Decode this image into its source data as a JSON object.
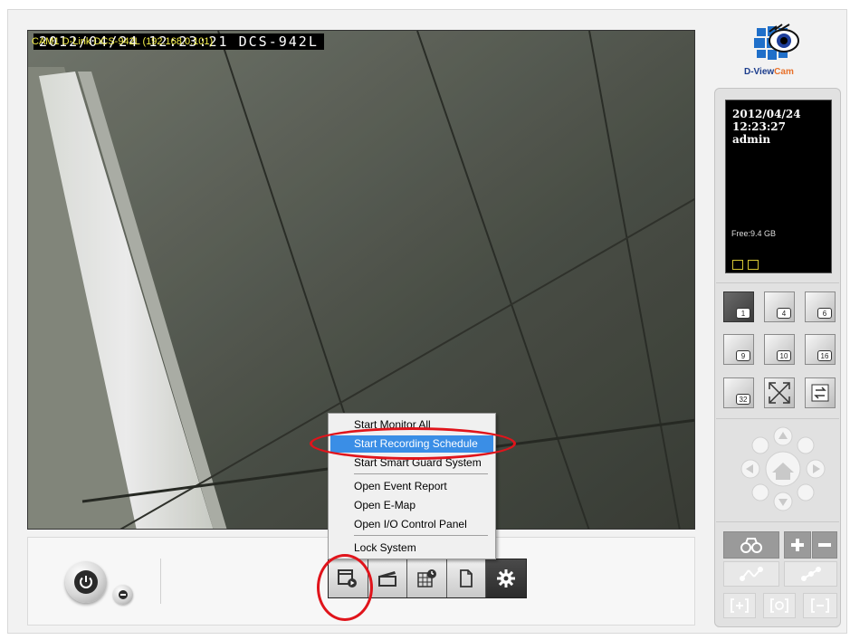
{
  "camera": {
    "osd_text": "2012/04/24 12:23:21  DCS-942L",
    "info_text": "CAM1 D-Link DCS-942L (192.168.0.101)"
  },
  "brand": {
    "logo_text_1": "D-View",
    "logo_text_2": "Cam"
  },
  "status_panel": {
    "date": "2012/04/24",
    "time": "12:23:27",
    "user": "admin",
    "free_space": "Free:9.4 GB"
  },
  "context_menu": {
    "items": [
      {
        "label": "Start Monitor All",
        "highlighted": false
      },
      {
        "label": "Start Recording Schedule",
        "highlighted": true
      },
      {
        "label": "Start Smart Guard System",
        "highlighted": false
      },
      {
        "label": "Open Event Report",
        "highlighted": false
      },
      {
        "label": "Open E-Map",
        "highlighted": false
      },
      {
        "label": "Open I/O Control Panel",
        "highlighted": false
      },
      {
        "label": "Lock System",
        "highlighted": false
      }
    ]
  },
  "toolbar": {
    "buttons": [
      "schedule-icon",
      "clapperboard-icon",
      "grid-clock-icon",
      "document-icon",
      "gear-icon"
    ]
  },
  "layout_buttons": [
    "1",
    "4",
    "6",
    "9",
    "10",
    "16",
    "32"
  ],
  "colors": {
    "menu_highlight": "#3a8ee6",
    "annotation_red": "#e0141b",
    "osd_yellow": "#f5ef4a"
  }
}
